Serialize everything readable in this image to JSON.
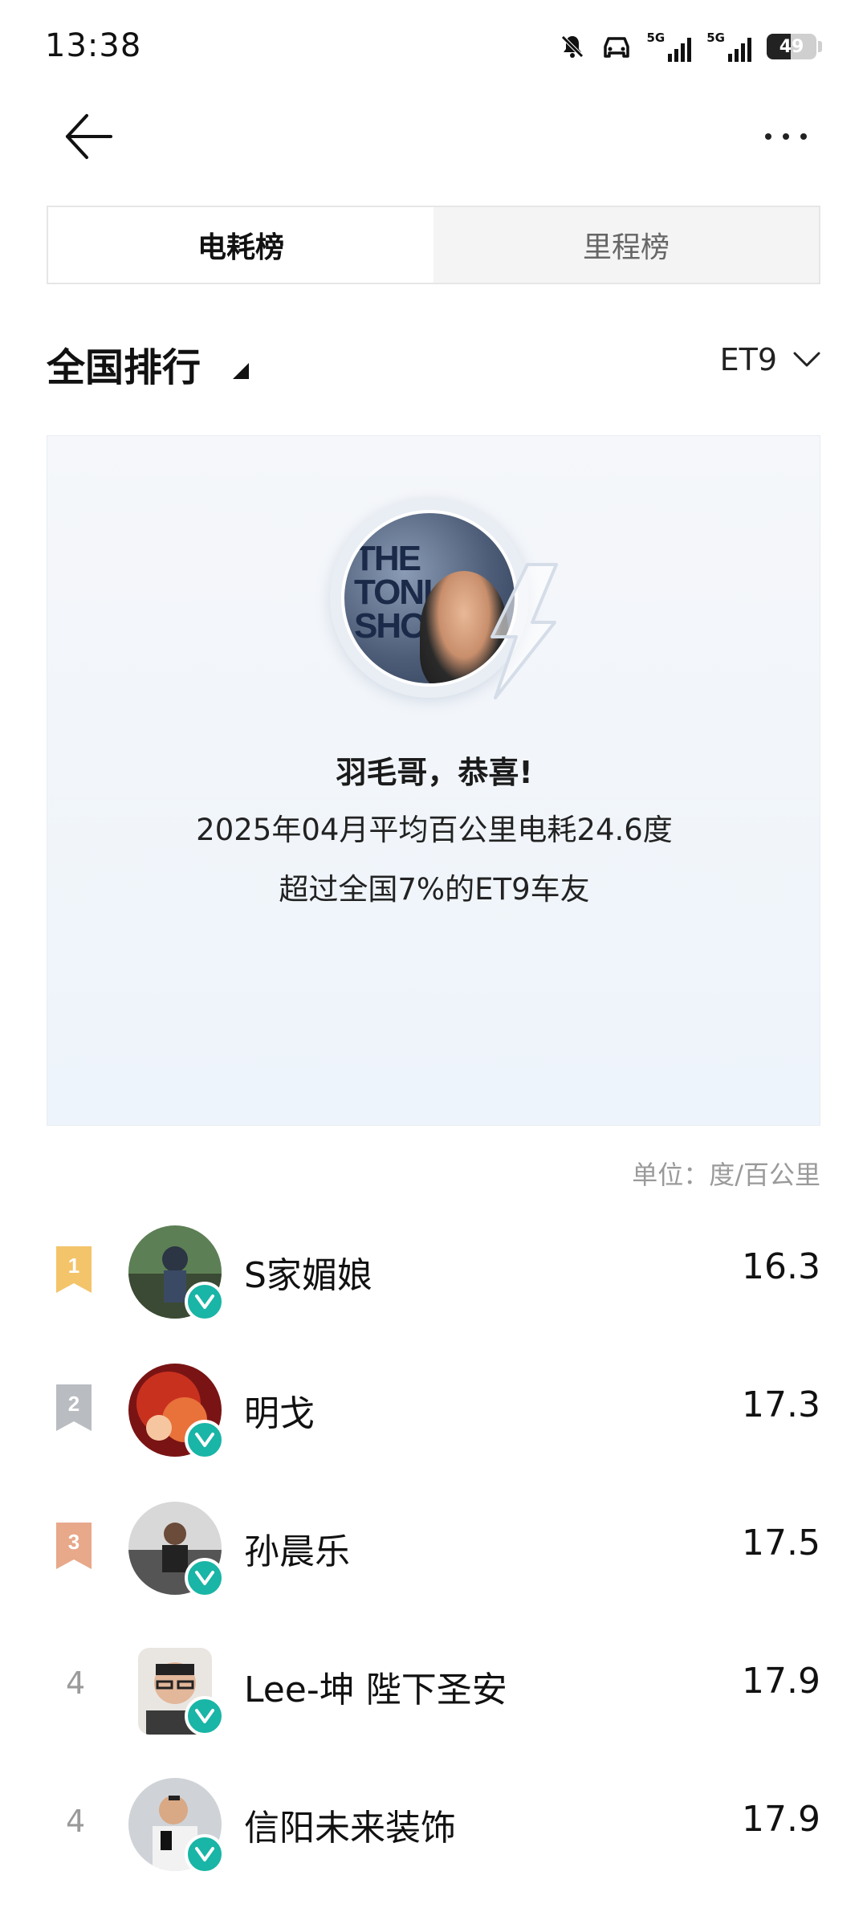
{
  "status": {
    "time": "13:38",
    "network1": "5G",
    "network2": "5G",
    "battery": "49"
  },
  "tabs": [
    {
      "label": "电耗榜",
      "active": true
    },
    {
      "label": "里程榜",
      "active": false
    }
  ],
  "ranking": {
    "title": "全国排行",
    "model": "ET9",
    "unit": "单位：度/百公里"
  },
  "summary": {
    "avatar_text": "THE TONI SHOW STARRING JIM FALL",
    "congrats": "羽毛哥，恭喜!",
    "line1": "2025年04月平均百公里电耗24.6度",
    "line2": "超过全国7%的ET9车友"
  },
  "list": [
    {
      "rank": "1",
      "name": "S家媚娘",
      "value": "16.3"
    },
    {
      "rank": "2",
      "name": "明戈",
      "value": "17.3"
    },
    {
      "rank": "3",
      "name": "孙晨乐",
      "value": "17.5"
    },
    {
      "rank": "4",
      "name": "Lee-坤 陛下圣安",
      "value": "17.9"
    },
    {
      "rank": "4",
      "name": "信阳未来装饰",
      "value": "17.9"
    }
  ],
  "colors": {
    "gold": "#f3c46a",
    "silver": "#b9bcc1",
    "bronze": "#e8a88a",
    "verified": "#19b5a6"
  }
}
